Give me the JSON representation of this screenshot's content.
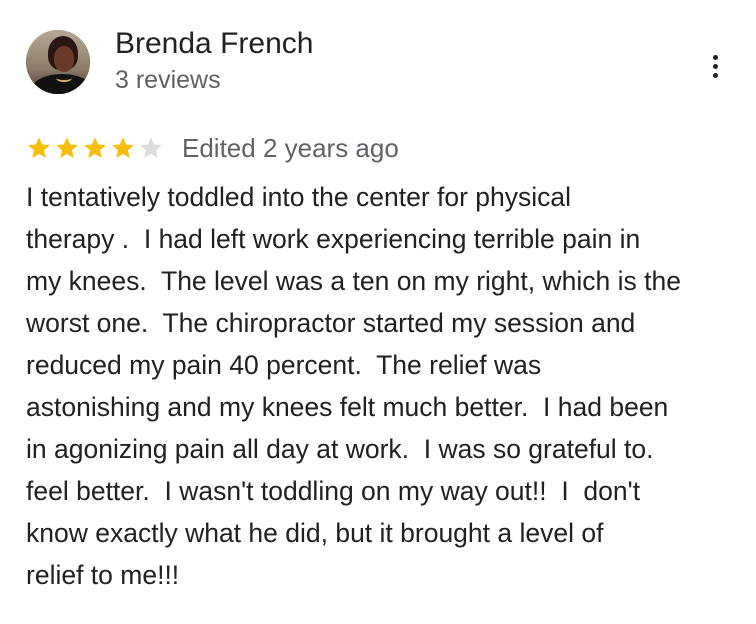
{
  "reviewer": {
    "name": "Brenda French",
    "review_count": "3 reviews",
    "avatar_icon": "profile-photo"
  },
  "menu": {
    "icon": "more-vert-icon"
  },
  "rating": {
    "stars": 4,
    "max_stars": 5,
    "filled_color": "#fbbc04",
    "empty_color": "#dadce0",
    "edited_label": "Edited 2 years ago"
  },
  "review": {
    "lines": [
      "I tentatively toddled into the center for physical",
      "therapy .  I had left work experiencing terrible pain in",
      "my knees.  The level was a ten on my right, which is the",
      "worst one.  The chiropractor started my session and",
      "reduced my pain 40 percent.  The relief was",
      "astonishing and my knees felt much better.  I had been",
      "in agonizing pain all day at work.  I was so grateful to.",
      "feel better.  I wasn't toddling on my way out!!  I  don't",
      "know exactly what he did, but it brought a level of",
      "relief to me!!!"
    ]
  }
}
